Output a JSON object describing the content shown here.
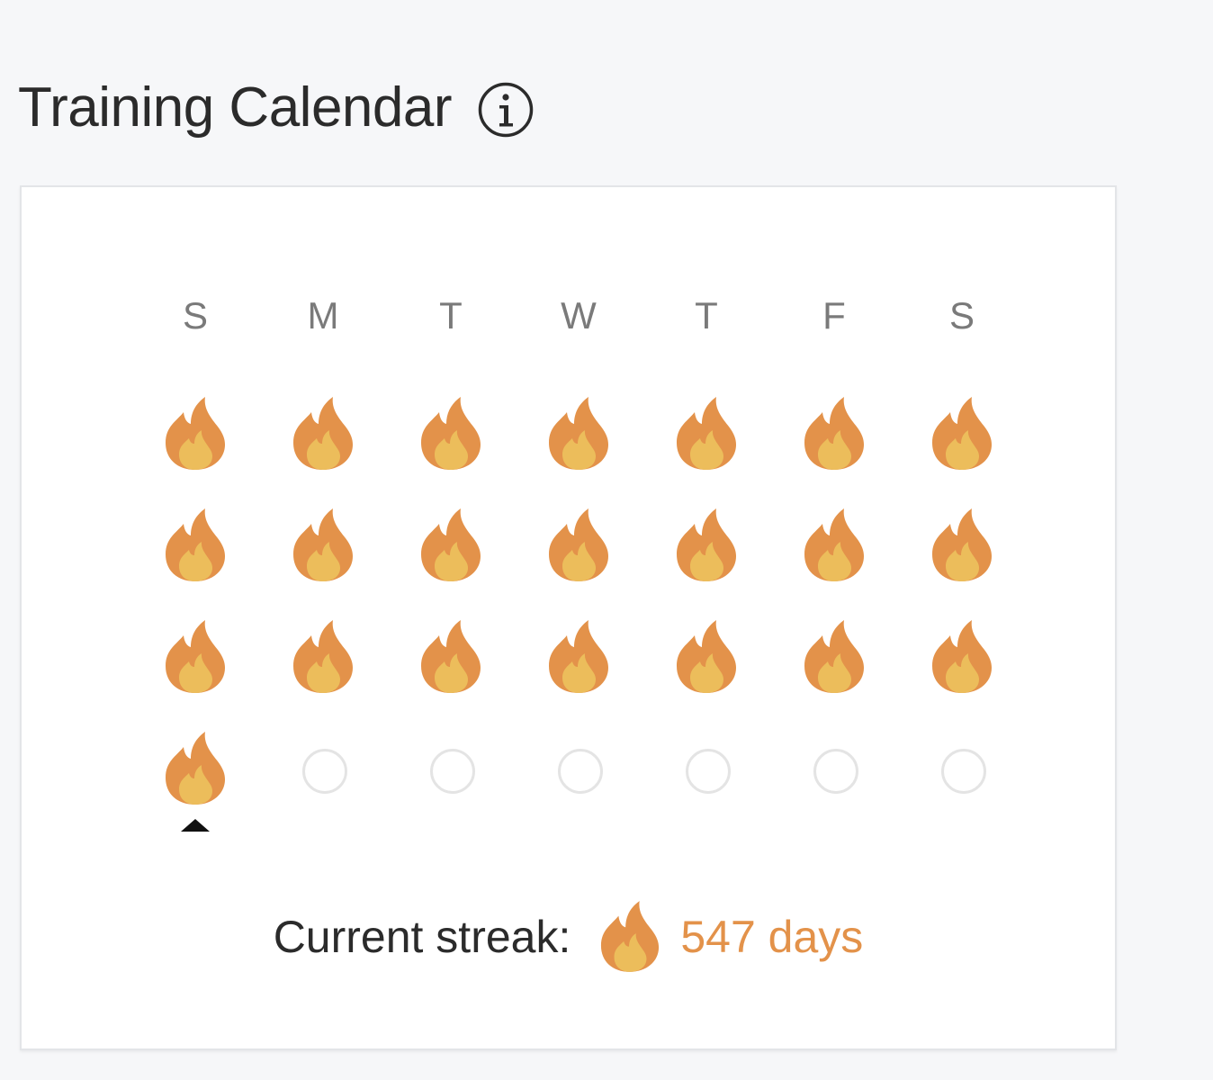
{
  "header": {
    "title": "Training Calendar",
    "info_icon": "info-icon"
  },
  "calendar": {
    "weekdays": [
      "S",
      "M",
      "T",
      "W",
      "T",
      "F",
      "S"
    ],
    "weeks": [
      [
        "flame",
        "flame",
        "flame",
        "flame",
        "flame",
        "flame",
        "flame"
      ],
      [
        "flame",
        "flame",
        "flame",
        "flame",
        "flame",
        "flame",
        "flame"
      ],
      [
        "flame",
        "flame",
        "flame",
        "flame",
        "flame",
        "flame",
        "flame"
      ],
      [
        "flame",
        "empty",
        "empty",
        "empty",
        "empty",
        "empty",
        "empty"
      ]
    ],
    "today_week": 3,
    "today_day": 0,
    "flame_colors": {
      "outer": "#e3924a",
      "inner": "#ecbd5b"
    }
  },
  "streak": {
    "label": "Current streak:",
    "value": "547 days",
    "icon": "flame-icon",
    "value_color": "#e3924a"
  }
}
